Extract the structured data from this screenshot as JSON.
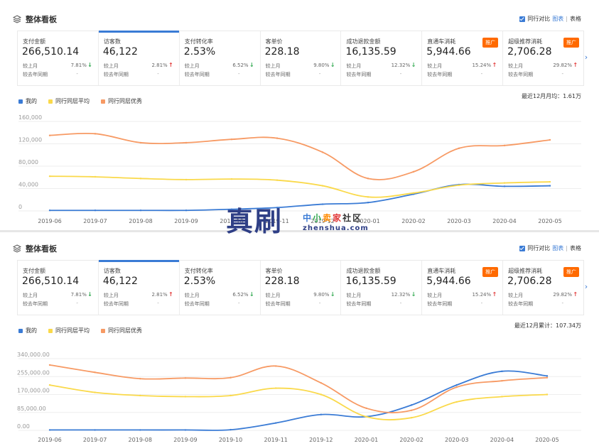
{
  "header": {
    "title": "整体看板",
    "compare_label": "同行对比",
    "view_chart": "图表",
    "sep": "|",
    "view_table": "表格"
  },
  "metrics": [
    {
      "label": "支付金额",
      "value": "266,510.14",
      "cmp_month": "较上月",
      "cmp_year": "较去年同期",
      "pct": "7.81%",
      "trend": "down",
      "dash": "-",
      "badge": ""
    },
    {
      "label": "访客数",
      "value": "46,122",
      "cmp_month": "较上月",
      "cmp_year": "较去年同期",
      "pct": "2.81%",
      "trend": "up",
      "dash": "-",
      "badge": ""
    },
    {
      "label": "支付转化率",
      "value": "2.53%",
      "cmp_month": "较上月",
      "cmp_year": "较去年同期",
      "pct": "6.52%",
      "trend": "down",
      "dash": "-",
      "badge": ""
    },
    {
      "label": "客单价",
      "value": "228.18",
      "cmp_month": "较上月",
      "cmp_year": "较去年同期",
      "pct": "9.80%",
      "trend": "down",
      "dash": "-",
      "badge": ""
    },
    {
      "label": "成功退款金额",
      "value": "16,135.59",
      "cmp_month": "较上月",
      "cmp_year": "较去年同期",
      "pct": "12.32%",
      "trend": "down",
      "dash": "-",
      "badge": ""
    },
    {
      "label": "直通车消耗",
      "value": "5,944.66",
      "cmp_month": "较上月",
      "cmp_year": "较去年同期",
      "pct": "15.24%",
      "trend": "up",
      "dash": "-",
      "badge": "推广"
    },
    {
      "label": "超级推荐消耗",
      "value": "2,706.28",
      "cmp_month": "较上月",
      "cmp_year": "较去年同期",
      "pct": "29.82%",
      "trend": "up",
      "dash": "-",
      "badge": "推广"
    }
  ],
  "legend": {
    "mine": "我的",
    "avg": "同行同层平均",
    "top": "同行同层优秀"
  },
  "colors": {
    "mine": "#3a7bd5",
    "avg": "#fad94a",
    "top": "#f79a64",
    "accent": "#3a7bd5",
    "badge": "#ff6a00",
    "up": "#e23b3b",
    "down": "#2fa84f"
  },
  "summaries": [
    "最近12月月均：1.61万",
    "最近12月累计：107.34万"
  ],
  "watermark": {
    "big": "真刷",
    "cn": [
      "中",
      "小",
      "卖",
      "家",
      "社",
      "区"
    ],
    "url": "zhenshua.com"
  },
  "chart_data": [
    {
      "type": "line",
      "title": "",
      "categories": [
        "2019-06",
        "2019-07",
        "2019-08",
        "2019-09",
        "2019-10",
        "2019-11",
        "2019-12",
        "2020-01",
        "2020-02",
        "2020-03",
        "2020-04",
        "2020-05"
      ],
      "yticks": [
        "0",
        "40,000",
        "80,000",
        "120,000",
        "160,000"
      ],
      "ylim": [
        0,
        160000
      ],
      "grid": true,
      "legend_position": "top-left",
      "series": [
        {
          "name": "我的",
          "key": "mine",
          "values": [
            1000,
            1000,
            1000,
            1000,
            3000,
            6000,
            12000,
            15000,
            30000,
            47000,
            44000,
            45000
          ]
        },
        {
          "name": "同行同层平均",
          "key": "avg",
          "values": [
            62000,
            61000,
            58000,
            56000,
            57000,
            55000,
            45000,
            25000,
            32000,
            46000,
            50000,
            52000
          ]
        },
        {
          "name": "同行同层优秀",
          "key": "top",
          "values": [
            135000,
            138000,
            122000,
            122000,
            128000,
            130000,
            105000,
            58000,
            70000,
            112000,
            117000,
            127000
          ]
        }
      ]
    },
    {
      "type": "line",
      "title": "",
      "categories": [
        "2019-06",
        "2019-07",
        "2019-08",
        "2019-09",
        "2019-10",
        "2019-11",
        "2019-12",
        "2020-01",
        "2020-02",
        "2020-03",
        "2020-04",
        "2020-05"
      ],
      "yticks": [
        "0.00",
        "85,000.00",
        "170,000.00",
        "255,000.00",
        "340,000.00"
      ],
      "ylim": [
        0,
        340000
      ],
      "grid": true,
      "legend_position": "top-left",
      "series": [
        {
          "name": "我的",
          "key": "mine",
          "values": [
            2000,
            2000,
            2000,
            2000,
            3000,
            35000,
            75000,
            65000,
            120000,
            215000,
            280000,
            258000
          ]
        },
        {
          "name": "同行同层平均",
          "key": "avg",
          "values": [
            215000,
            180000,
            165000,
            160000,
            165000,
            200000,
            170000,
            65000,
            60000,
            135000,
            160000,
            170000
          ]
        },
        {
          "name": "同行同层优秀",
          "key": "top",
          "values": [
            310000,
            275000,
            245000,
            248000,
            250000,
            305000,
            225000,
            105000,
            95000,
            205000,
            235000,
            250000
          ]
        }
      ]
    }
  ]
}
